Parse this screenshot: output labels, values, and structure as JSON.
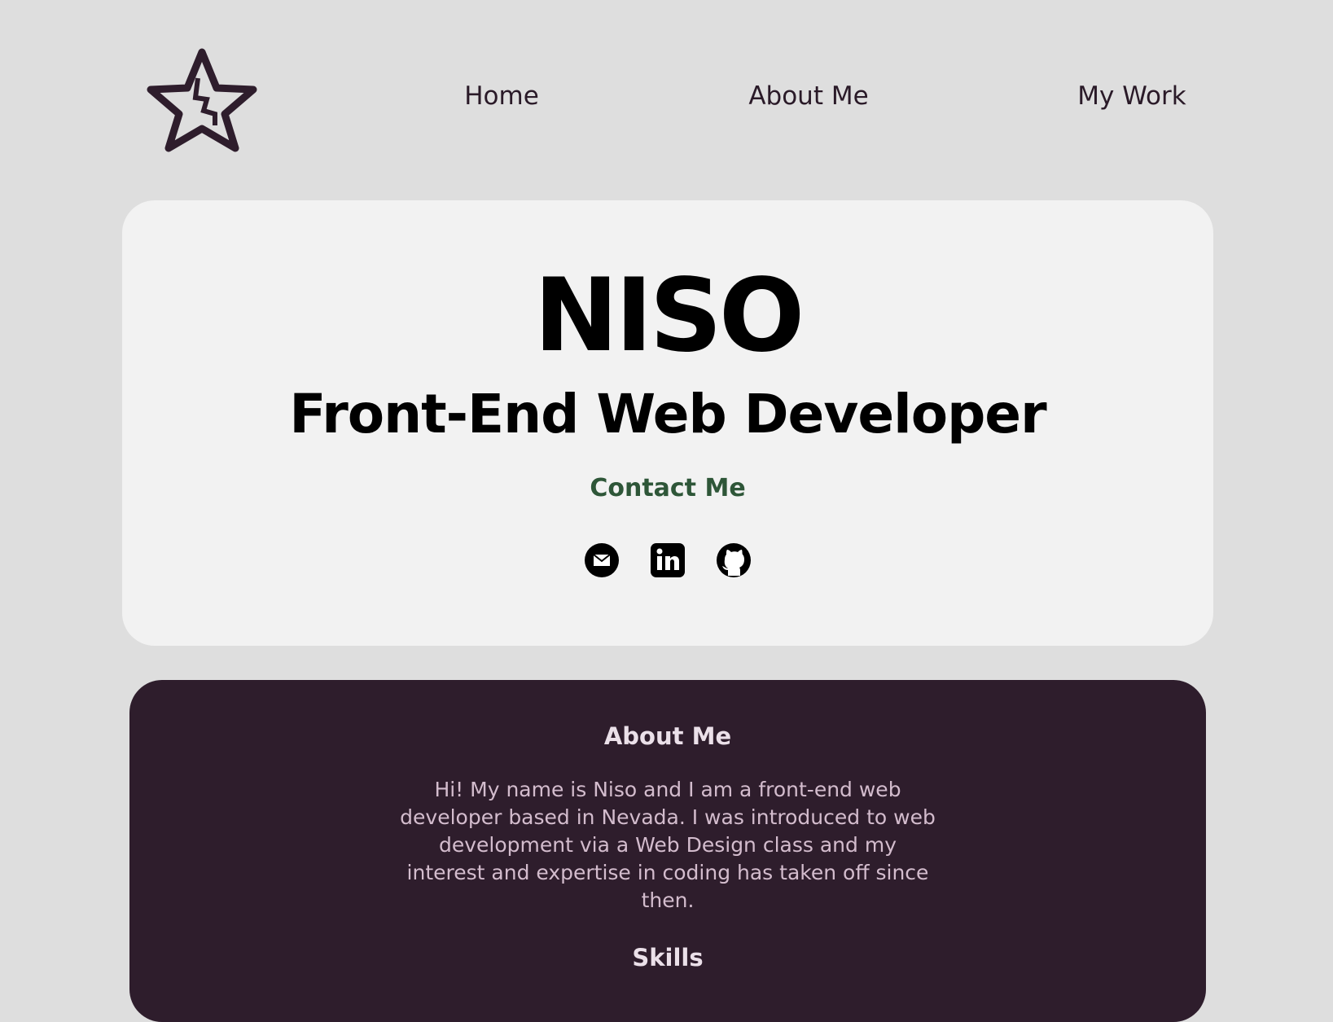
{
  "nav": {
    "logo": "broken-star-logo",
    "items": [
      {
        "label": "Home"
      },
      {
        "label": "About Me"
      },
      {
        "label": "My Work"
      }
    ]
  },
  "hero": {
    "name": "NISO",
    "role": "Front-End Web Developer",
    "contact_label": "Contact Me",
    "icons": [
      "email-icon",
      "linkedin-icon",
      "github-icon"
    ]
  },
  "about": {
    "heading": "About Me",
    "text": "Hi! My name is Niso and I am a front-end web developer based in Nevada. I was introduced to web development via a Web Design class and my interest and expertise in coding has taken off since then.",
    "skills_heading": "Skills"
  },
  "colors": {
    "background": "#dedede",
    "card": "#f2f2f2",
    "dark": "#2e1d2c",
    "accent": "#2e5638"
  }
}
